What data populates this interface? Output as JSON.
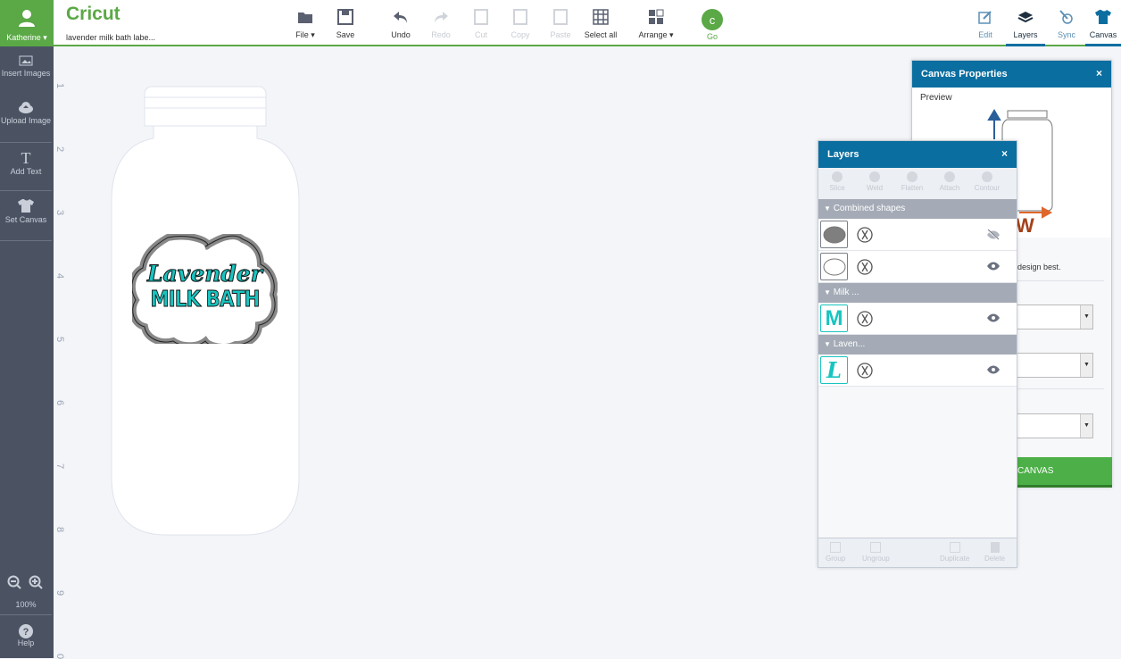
{
  "user": {
    "name": "Katherine ▾"
  },
  "app": {
    "logo": "Cricut",
    "project_name": "lavender milk bath labe..."
  },
  "toolbar": [
    {
      "label": "File ▾",
      "icon": "folder-icon",
      "enabled": true
    },
    {
      "label": "Save",
      "icon": "save-icon",
      "enabled": true
    },
    {
      "label": "Undo",
      "icon": "undo-icon",
      "enabled": true
    },
    {
      "label": "Redo",
      "icon": "redo-icon",
      "enabled": false
    },
    {
      "label": "Cut",
      "icon": "cut-icon",
      "enabled": false
    },
    {
      "label": "Copy",
      "icon": "copy-icon",
      "enabled": false
    },
    {
      "label": "Paste",
      "icon": "paste-icon",
      "enabled": false
    },
    {
      "label": "Select all",
      "icon": "select-all-icon",
      "enabled": true
    },
    {
      "label": "Arrange ▾",
      "icon": "arrange-icon",
      "enabled": true
    },
    {
      "label": "Go",
      "icon": "go-icon",
      "enabled": true
    }
  ],
  "right_tabs": [
    {
      "label": "Edit"
    },
    {
      "label": "Layers",
      "active": true
    },
    {
      "label": "Sync"
    },
    {
      "label": "Canvas",
      "active": true
    }
  ],
  "sidebar": [
    {
      "label": "Insert Images"
    },
    {
      "label": "Upload Image"
    },
    {
      "label": "Add Text"
    },
    {
      "label": "Set Canvas"
    }
  ],
  "zoom": {
    "level": "100%"
  },
  "help": {
    "label": "Help"
  },
  "ruler": [
    "1",
    "2",
    "3",
    "4",
    "5",
    "6",
    "7",
    "8",
    "9",
    "0"
  ],
  "design": {
    "line1": "Lavender",
    "line2": "MILK BATH"
  },
  "canvas_properties": {
    "title": "Canvas Properties",
    "close": "×",
    "preview_label": "Preview",
    "preview_w": "W",
    "hint": "design best.",
    "button": "CANVAS"
  },
  "layers": {
    "title": "Layers",
    "close": "×",
    "tools": [
      "Slice",
      "Weld",
      "Flatten",
      "Attach",
      "Contour"
    ],
    "groups": [
      {
        "name": "Combined shapes",
        "rows": [
          {
            "thumb": "filled-label",
            "visible": false
          },
          {
            "thumb": "outline-label",
            "visible": true
          }
        ]
      },
      {
        "name": "Milk ...",
        "rows": [
          {
            "thumb": "M",
            "visible": true
          }
        ]
      },
      {
        "name": "Laven...",
        "rows": [
          {
            "thumb": "L",
            "visible": true
          }
        ]
      }
    ],
    "footer": [
      "Group",
      "Ungroup",
      "Duplicate",
      "Delete"
    ]
  },
  "colors": {
    "green": "#5aa846",
    "blue": "#0a6ea0",
    "teal": "#18c4c0",
    "sidebar": "#4b5363"
  }
}
